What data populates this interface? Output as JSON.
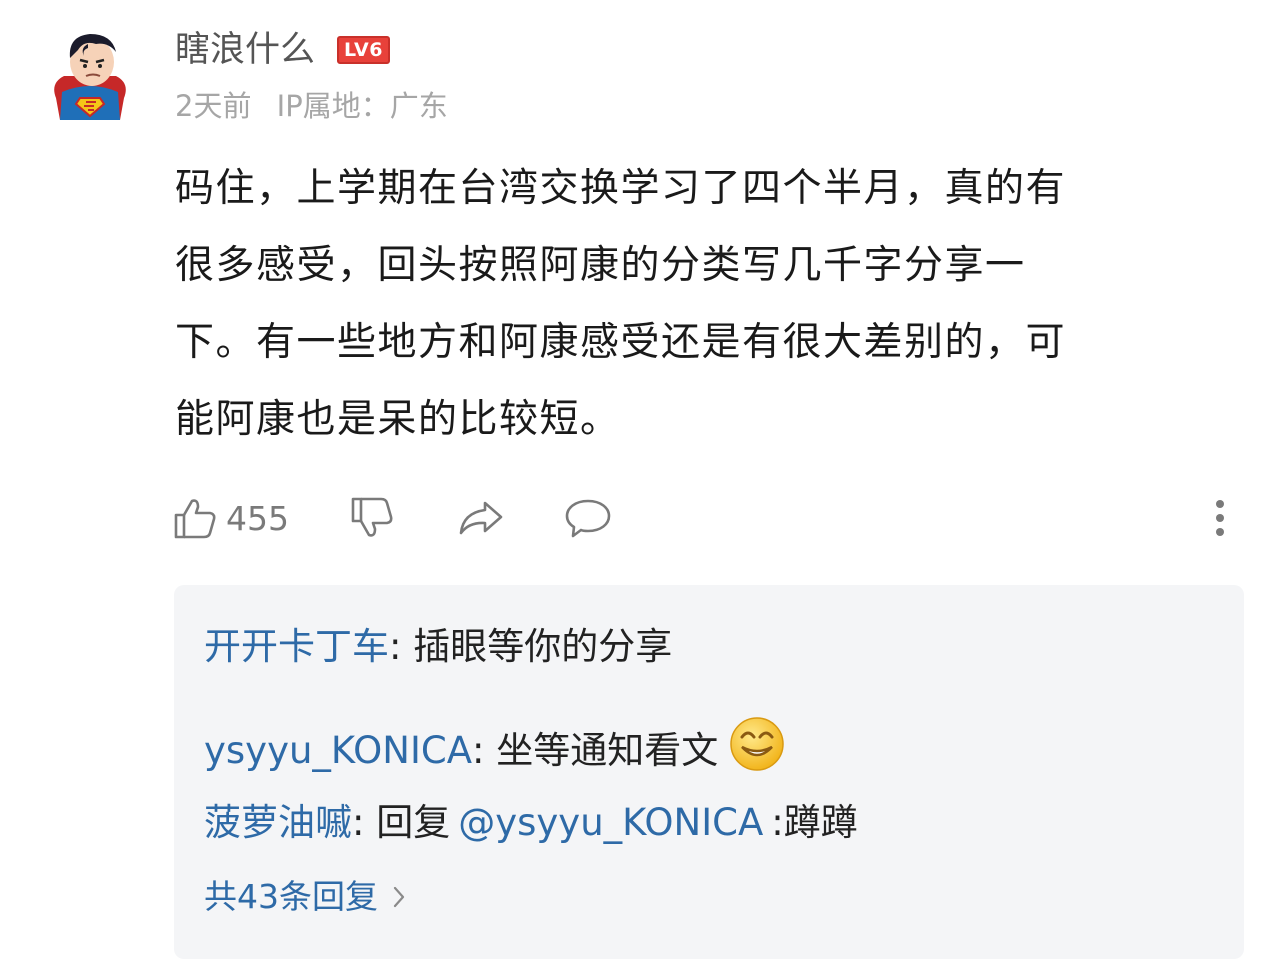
{
  "comment": {
    "username": "瞎浪什么",
    "level": "LV6",
    "time": "2天前",
    "ip_location": "IP属地：广东",
    "content_lines": [
      "码住，上学期在台湾交换学习了四个半月，真的有",
      "很多感受，回头按照阿康的分类写几千字分享一",
      "下。有一些地方和阿康感受还是有很大差别的，可",
      "能阿康也是呆的比较短。"
    ],
    "like_count": "455"
  },
  "replies": [
    {
      "user": "开开卡丁车",
      "separator": ": ",
      "text": "插眼等你的分享"
    },
    {
      "user": "ysyyu_KONICA",
      "separator": ": ",
      "text": "坐等通知看文",
      "emoji": "smile-emoji"
    },
    {
      "user": "菠萝油嘁",
      "separator": ": ",
      "prefix": "回复",
      "mention": "@ysyyu_KONICA",
      "text": ":蹲蹲"
    }
  ],
  "more_replies_label": "共43条回复",
  "icons": {
    "like": "thumbs-up-icon",
    "dislike": "thumbs-down-icon",
    "share": "share-icon",
    "reply": "comment-bubble-icon",
    "more": "more-vertical-icon",
    "expand": "chevron-right-icon"
  },
  "colors": {
    "link": "#2e6aa7",
    "level_badge": "#e8413a",
    "reply_background": "#f4f5f7"
  }
}
